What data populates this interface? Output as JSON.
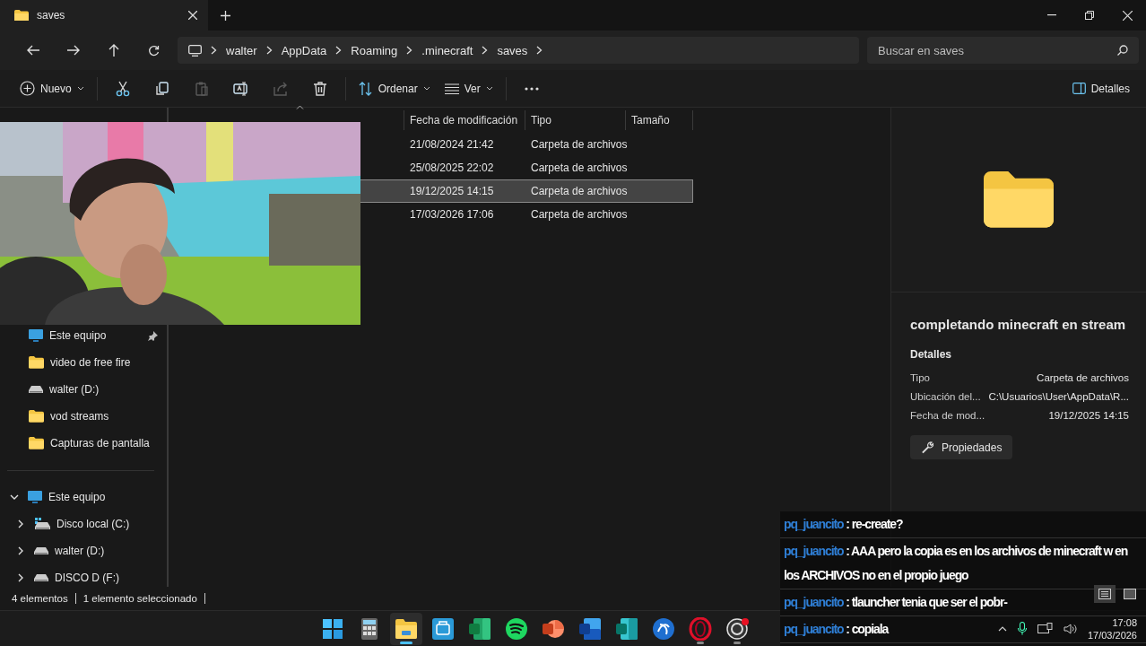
{
  "tab": {
    "title": "saves"
  },
  "address": {
    "crumbs": [
      "walter",
      "AppData",
      "Roaming",
      ".minecraft",
      "saves"
    ]
  },
  "search": {
    "placeholder": "Buscar en saves"
  },
  "toolbar": {
    "new": "Nuevo",
    "actions": [
      {
        "kind": "cut",
        "disabled": false
      },
      {
        "kind": "copy",
        "disabled": false
      },
      {
        "kind": "paste",
        "disabled": true
      },
      {
        "kind": "rename",
        "disabled": false
      },
      {
        "kind": "share",
        "disabled": true
      },
      {
        "kind": "delete",
        "disabled": false
      }
    ],
    "sort": "Ordenar",
    "view": "Ver",
    "details": "Detalles"
  },
  "sidebar": {
    "quick_access": [
      {
        "label": "Este equipo",
        "kind": "pc",
        "pinned": true
      },
      {
        "label": "video  de free fire",
        "kind": "folder",
        "pinned": false
      },
      {
        "label": "walter (D:)",
        "kind": "drive",
        "pinned": false
      },
      {
        "label": "vod streams",
        "kind": "folder",
        "pinned": false
      },
      {
        "label": "Capturas de pantalla",
        "kind": "folder",
        "pinned": false
      }
    ],
    "tree": [
      {
        "label": "Este equipo",
        "kind": "pc",
        "expanded": true,
        "children": [
          {
            "label": "Disco local (C:)",
            "kind": "system_drive",
            "expanded": false
          },
          {
            "label": "walter (D:)",
            "kind": "drive",
            "expanded": false
          },
          {
            "label": "DISCO D (F:)",
            "kind": "drive",
            "expanded": false
          }
        ]
      }
    ]
  },
  "table": {
    "columns": [
      "Fecha de modificación",
      "Tipo",
      "Tamaño"
    ],
    "rows": [
      {
        "modified": "21/08/2024 21:42",
        "type": "Carpeta de archivos",
        "selected": false
      },
      {
        "modified": "25/08/2025 22:02",
        "type": "Carpeta de archivos",
        "selected": false
      },
      {
        "modified": "19/12/2025 14:15",
        "type": "Carpeta de archivos",
        "selected": true
      },
      {
        "modified": "17/03/2026 17:06",
        "type": "Carpeta de archivos",
        "selected": false
      }
    ]
  },
  "details_pane": {
    "title": "completando minecraft en stream",
    "section": "Detalles",
    "properties": [
      {
        "label": "Tipo",
        "value": "Carpeta de archivos"
      },
      {
        "label": "Ubicación del...",
        "value": "C:\\Usuarios\\User\\AppData\\R..."
      },
      {
        "label": "Fecha de mod...",
        "value": "19/12/2025 14:15"
      }
    ],
    "button": "Propiedades"
  },
  "status_bar": {
    "count": "4 elementos",
    "selection": "1 elemento seleccionado"
  },
  "chat": [
    {
      "user": "pq_juancito",
      "separator": ":",
      "text": "re-create?"
    },
    {
      "user": "pq_juancito",
      "separator": ":",
      "text": "AAA pero la copia es en los archivos de minecraft w en los ARCHIVOS no en el propio juego"
    },
    {
      "user": "pq_juancito",
      "separator": ":",
      "text": "tlauncher tenia que ser el pobr-"
    },
    {
      "user": "pq_juancito",
      "separator": ":",
      "text": "copiala"
    }
  ],
  "taskbar": {
    "apps": [
      {
        "kind": "start",
        "active": false,
        "running": false
      },
      {
        "kind": "calculator",
        "active": false,
        "running": false
      },
      {
        "kind": "explorer",
        "active": true,
        "running": true
      },
      {
        "kind": "store",
        "active": false,
        "running": false
      },
      {
        "kind": "excel",
        "active": false,
        "running": false
      },
      {
        "kind": "spotify",
        "active": false,
        "running": false
      },
      {
        "kind": "powerpoint",
        "active": false,
        "running": false
      },
      {
        "kind": "word",
        "active": false,
        "running": false
      },
      {
        "kind": "publisher",
        "active": false,
        "running": false
      },
      {
        "kind": "launcher",
        "active": false,
        "running": false
      },
      {
        "kind": "opera",
        "active": false,
        "running": true
      },
      {
        "kind": "obs",
        "active": false,
        "running": true
      }
    ],
    "time": "17:08",
    "date": "17/03/2026"
  }
}
